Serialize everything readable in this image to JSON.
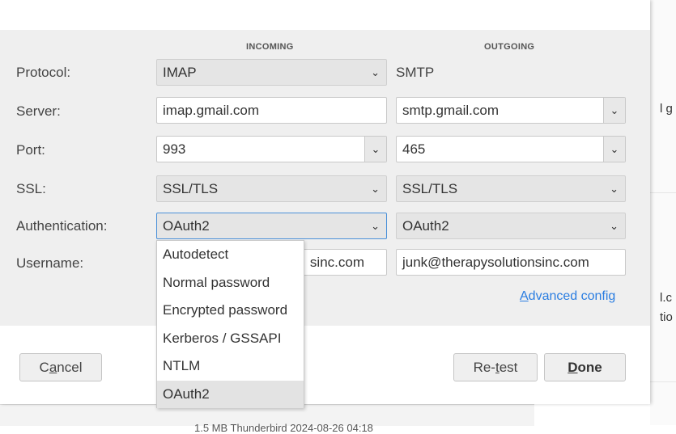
{
  "columns": {
    "incoming": "INCOMING",
    "outgoing": "OUTGOING"
  },
  "labels": {
    "protocol": "Protocol:",
    "server": "Server:",
    "port": "Port:",
    "ssl": "SSL:",
    "authentication": "Authentication:",
    "username": "Username:"
  },
  "incoming": {
    "protocol": "IMAP",
    "server": "imap.gmail.com",
    "port": "993",
    "ssl": "SSL/TLS",
    "authentication": "OAuth2",
    "username_visible_tail": "sinc.com"
  },
  "outgoing": {
    "protocol": "SMTP",
    "server": "smtp.gmail.com",
    "port": "465",
    "ssl": "SSL/TLS",
    "authentication": "OAuth2",
    "username": "junk@therapysolutionsinc.com"
  },
  "advanced_config": {
    "accesskey": "A",
    "rest": "dvanced config"
  },
  "buttons": {
    "cancel": {
      "pre": "C",
      "accesskey": "a",
      "post": "ncel"
    },
    "retest": {
      "pre": "Re-",
      "accesskey": "t",
      "post": "est"
    },
    "done": {
      "pre": "",
      "accesskey": "D",
      "post": "one"
    }
  },
  "auth_options": [
    "Autodetect",
    "Normal password",
    "Encrypted password",
    "Kerberos / GSSAPI",
    "NTLM",
    "OAuth2"
  ],
  "auth_selected_index": 5,
  "background": {
    "right_text_1": "l g",
    "right_text_2": "l.c",
    "right_text_3": "tio",
    "bottom_text": "1.5 MB      Thunderbird 2024-08-26 04:18"
  },
  "icons": {
    "dropdown": "chevron-down-icon"
  },
  "colors": {
    "link": "#2a7de1",
    "focus_border": "#4a90d9",
    "panel": "#efefef"
  }
}
